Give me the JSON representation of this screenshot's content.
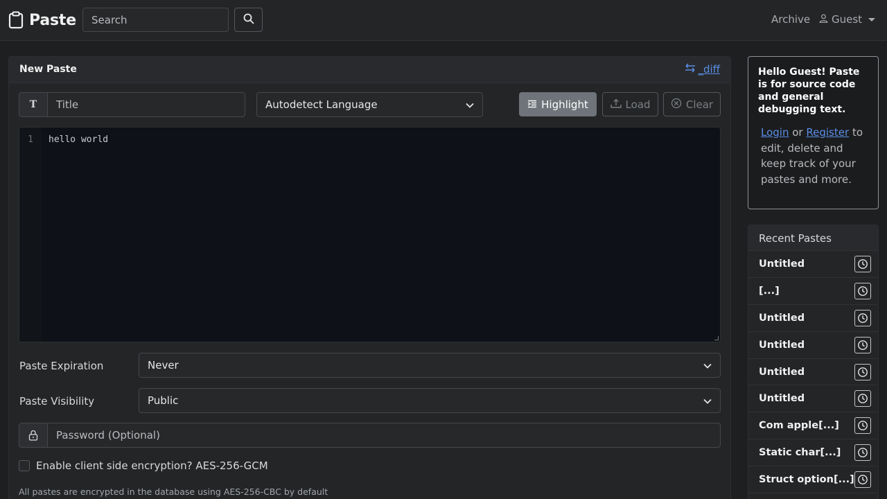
{
  "nav": {
    "brand": "Paste",
    "search_placeholder": "Search",
    "archive": "Archive",
    "user": "Guest"
  },
  "main": {
    "title": "New Paste",
    "diff_label": "_diff",
    "title_placeholder": "Title",
    "language": "Autodetect Language",
    "highlight_label": "Highlight",
    "load_label": "Load",
    "clear_label": "Clear",
    "editor": {
      "line_number": "1",
      "content": "hello world"
    },
    "expiration_label": "Paste Expiration",
    "expiration_value": "Never",
    "visibility_label": "Paste Visibility",
    "visibility_value": "Public",
    "password_placeholder": "Password (Optional)",
    "encryption_label": "Enable client side encryption? AES-256-GCM",
    "encryption_note": "All pastes are encrypted in the database using AES-256-CBC by default"
  },
  "sidebar": {
    "heading": "Hello Guest! Paste is for source code and general debugging text.",
    "login": "Login",
    "or": "or",
    "register": "Register",
    "info_rest": "to edit, delete and keep track of your pastes and more.",
    "recent_title": "Recent Pastes",
    "recent": [
      {
        "title": "Untitled"
      },
      {
        "title": "[...]"
      },
      {
        "title": "Untitled"
      },
      {
        "title": "Untitled"
      },
      {
        "title": "Untitled"
      },
      {
        "title": "Untitled"
      },
      {
        "title": "Com apple[...]"
      },
      {
        "title": "Static char[...]"
      },
      {
        "title": "Struct option[...]"
      }
    ]
  },
  "colors": {
    "background": "#1e1f21",
    "accent_link": "#5b8ee6",
    "highlight_button": "#6e7479"
  }
}
